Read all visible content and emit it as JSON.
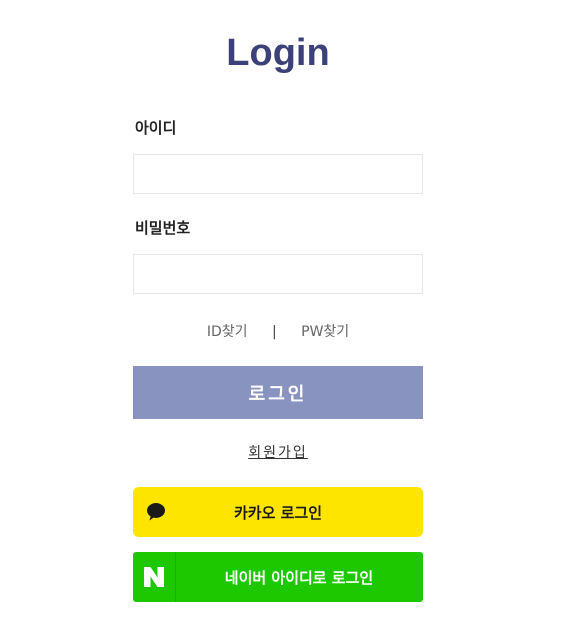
{
  "title": "Login",
  "form": {
    "id_label": "아이디",
    "id_value": "",
    "pw_label": "비밀번호",
    "pw_value": ""
  },
  "find_links": {
    "find_id": "ID찾기",
    "separator": "|",
    "find_pw": "PW찾기"
  },
  "login_button": "로그인",
  "signup_link": "회원가입",
  "social": {
    "kakao_label": "카카오 로그인",
    "kakao_icon": "speech-bubble-icon",
    "naver_label": "네이버 아이디로 로그인",
    "naver_icon": "naver-n-icon"
  },
  "colors": {
    "title": "#3c4279",
    "login_button": "#8993c0",
    "kakao": "#fee500",
    "naver": "#1ec800"
  }
}
